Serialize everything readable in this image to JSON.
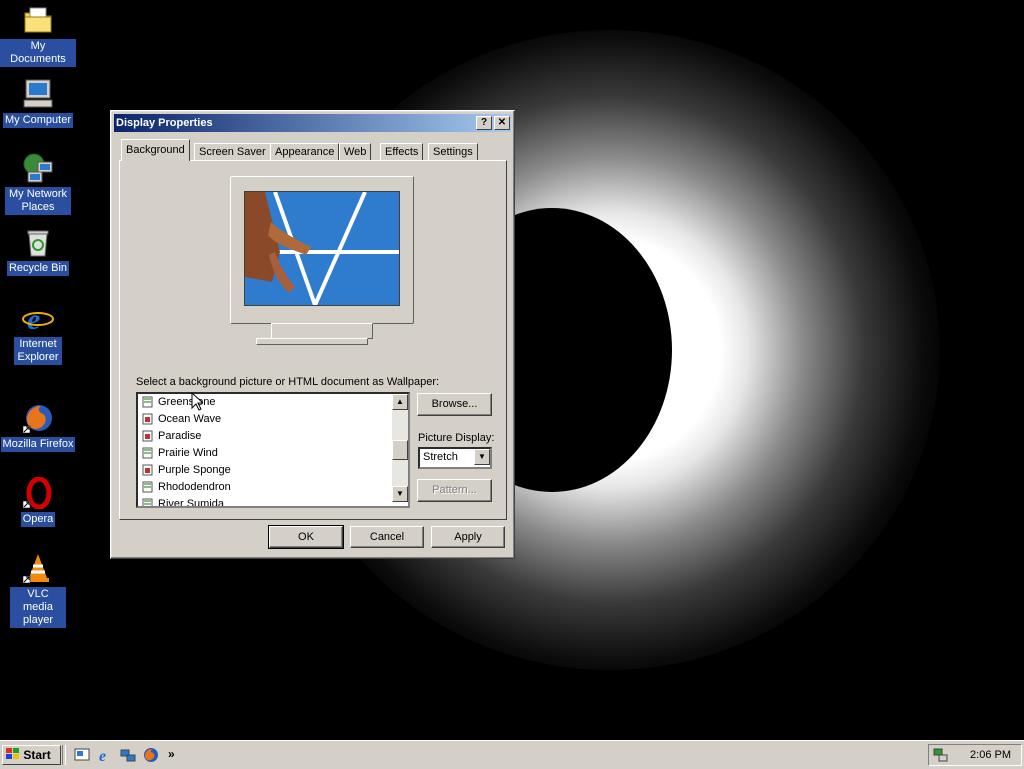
{
  "desktop": {
    "icons": [
      {
        "label": "My Documents"
      },
      {
        "label": "My Computer"
      },
      {
        "label": "My Network Places"
      },
      {
        "label": "Recycle Bin"
      },
      {
        "label": "Internet Explorer"
      },
      {
        "label": "Mozilla Firefox"
      },
      {
        "label": "Opera"
      },
      {
        "label": "VLC media player"
      }
    ]
  },
  "dialog": {
    "title": "Display Properties",
    "help_label": "?",
    "close_label": "✕",
    "tabs": [
      "Background",
      "Screen Saver",
      "Appearance",
      "Web",
      "Effects",
      "Settings"
    ],
    "prompt": "Select a background picture or HTML document as Wallpaper:",
    "wallpapers": [
      "Greenstone",
      "Ocean Wave",
      "Paradise",
      "Prairie Wind",
      "Purple Sponge",
      "Rhododendron",
      "River Sumida"
    ],
    "browse_label": "Browse...",
    "picture_display_label": "Picture Display:",
    "picture_display_value": "Stretch",
    "pattern_label": "Pattern...",
    "ok_label": "OK",
    "cancel_label": "Cancel",
    "apply_label": "Apply"
  },
  "taskbar": {
    "start_label": "Start",
    "more_label": "»",
    "clock": "2:06 PM"
  },
  "colors": {
    "titlebar_start": "#0a246a",
    "titlebar_end": "#a6caf0",
    "face": "#d4d0c8",
    "icon_label_bg": "#2a4fa0"
  }
}
